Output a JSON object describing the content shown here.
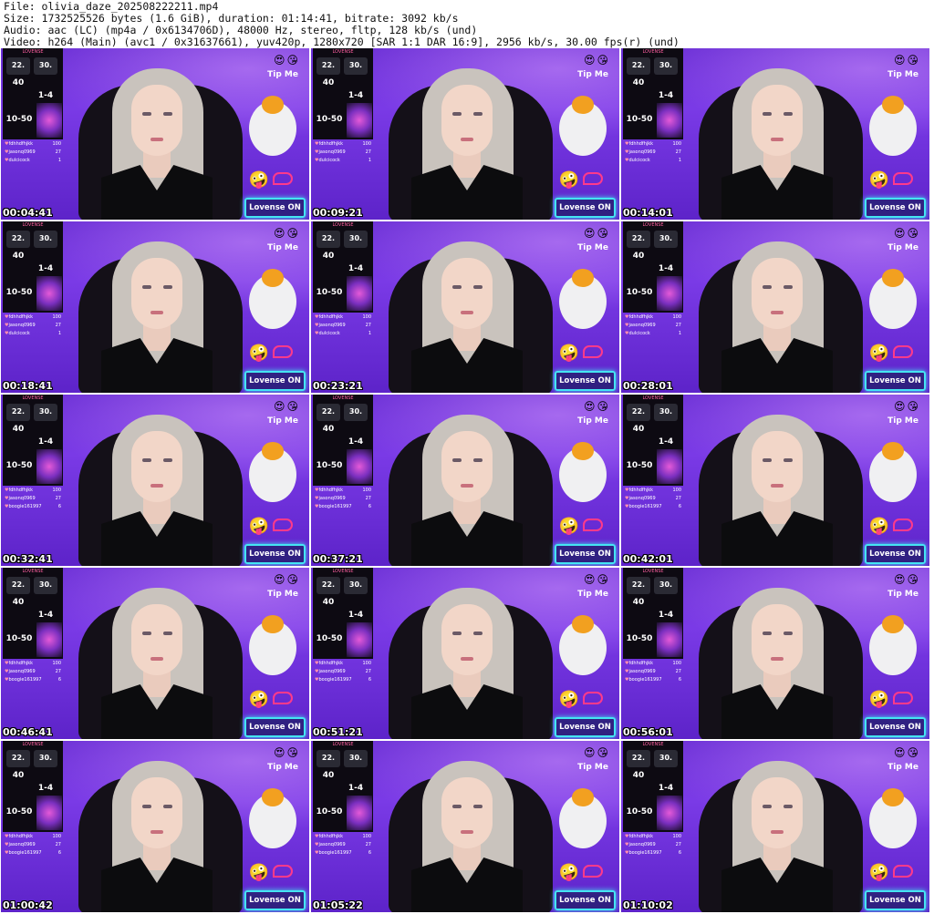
{
  "meta": {
    "line1": "File: olivia_daze_202508222211.mp4",
    "line2": "Size: 1732525526 bytes (1.6 GiB), duration: 01:14:41, bitrate: 3092 kb/s",
    "line3": "Audio: aac (LC) (mp4a / 0x6134706D), 48000 Hz, stereo, fltp, 128 kb/s (und)",
    "line4": "Video: h264 (Main) (avc1 / 0x31637661), yuv420p, 1280x720 [SAR 1:1 DAR 16:9], 2956 kb/s, 30.00 fps(r) (und)"
  },
  "overlay": {
    "panel_title": "LOVENSE",
    "cells": [
      "22.",
      "30.",
      "40",
      "1-4",
      "10-50"
    ],
    "tip_me": "Tip Me",
    "lovense_button": "Lovense ON",
    "emojis": "😍😘",
    "smiley": "🤪"
  },
  "frames": [
    {
      "time": "00:04:41",
      "tippers": [
        [
          "fdhhdfhjkk",
          "100"
        ],
        [
          "jasonq0969",
          "27"
        ],
        [
          "dulcicock",
          "1"
        ]
      ]
    },
    {
      "time": "00:09:21",
      "tippers": [
        [
          "fdhhdfhjkk",
          "100"
        ],
        [
          "jasonq0969",
          "27"
        ],
        [
          "dulcicock",
          "1"
        ]
      ]
    },
    {
      "time": "00:14:01",
      "tippers": [
        [
          "fdhhdfhjkk",
          "100"
        ],
        [
          "jasonq0969",
          "27"
        ],
        [
          "dulcicock",
          "1"
        ]
      ]
    },
    {
      "time": "00:18:41",
      "tippers": [
        [
          "fdhhdfhjkk",
          "100"
        ],
        [
          "jasonq0969",
          "27"
        ],
        [
          "dulcicock",
          "1"
        ]
      ]
    },
    {
      "time": "00:23:21",
      "tippers": [
        [
          "fdhhdfhjkk",
          "100"
        ],
        [
          "jasonq0969",
          "27"
        ],
        [
          "dulcicock",
          "1"
        ]
      ]
    },
    {
      "time": "00:28:01",
      "tippers": [
        [
          "fdhhdfhjkk",
          "100"
        ],
        [
          "jasonq0969",
          "27"
        ],
        [
          "dulcicock",
          "1"
        ]
      ]
    },
    {
      "time": "00:32:41",
      "tippers": [
        [
          "fdhhdfhjkk",
          "100"
        ],
        [
          "jasonq0969",
          "27"
        ],
        [
          "boogie161997",
          "6"
        ]
      ]
    },
    {
      "time": "00:37:21",
      "tippers": [
        [
          "fdhhdfhjkk",
          "100"
        ],
        [
          "jasonq0969",
          "27"
        ],
        [
          "boogie161997",
          "6"
        ]
      ]
    },
    {
      "time": "00:42:01",
      "tippers": [
        [
          "fdhhdfhjkk",
          "100"
        ],
        [
          "jasonq0969",
          "27"
        ],
        [
          "boogie161997",
          "6"
        ]
      ]
    },
    {
      "time": "00:46:41",
      "tippers": [
        [
          "fdhhdfhjkk",
          "100"
        ],
        [
          "jasonq0969",
          "27"
        ],
        [
          "boogie161997",
          "6"
        ]
      ]
    },
    {
      "time": "00:51:21",
      "tippers": [
        [
          "fdhhdfhjkk",
          "100"
        ],
        [
          "jasonq0969",
          "27"
        ],
        [
          "boogie161997",
          "6"
        ]
      ]
    },
    {
      "time": "00:56:01",
      "tippers": [
        [
          "fdhhdfhjkk",
          "100"
        ],
        [
          "jasonq0969",
          "27"
        ],
        [
          "boogie161997",
          "6"
        ]
      ]
    },
    {
      "time": "01:00:42",
      "tippers": [
        [
          "fdhhdfhjkk",
          "100"
        ],
        [
          "jasonq0969",
          "27"
        ],
        [
          "boogie161997",
          "6"
        ]
      ]
    },
    {
      "time": "01:05:22",
      "tippers": [
        [
          "fdhhdfhjkk",
          "100"
        ],
        [
          "jasonq0969",
          "27"
        ],
        [
          "boogie161997",
          "6"
        ]
      ]
    },
    {
      "time": "01:10:02",
      "tippers": [
        [
          "fdhhdfhjkk",
          "100"
        ],
        [
          "jasonq0969",
          "27"
        ],
        [
          "boogie161997",
          "6"
        ]
      ]
    }
  ]
}
